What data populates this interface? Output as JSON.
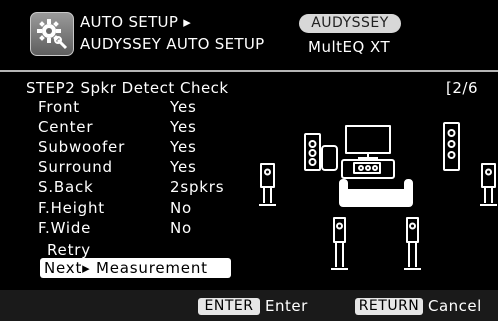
{
  "header": {
    "line1": "AUTO SETUP ▸",
    "line2": "AUDYSSEY AUTO SETUP",
    "badge": "AUDYSSEY",
    "subtitle": "MultEQ XT",
    "icon": "setup-gear-icon"
  },
  "step": {
    "title": "STEP2 Spkr Detect Check",
    "page": "[2/6"
  },
  "speakers": [
    {
      "label": "Front",
      "value": "Yes"
    },
    {
      "label": "Center",
      "value": "Yes"
    },
    {
      "label": "Subwoofer",
      "value": "Yes"
    },
    {
      "label": "Surround",
      "value": "Yes"
    },
    {
      "label": "S.Back",
      "value": "2spkrs"
    },
    {
      "label": "F.Height",
      "value": "No"
    },
    {
      "label": "F.Wide",
      "value": "No"
    }
  ],
  "actions": {
    "retry": "Retry",
    "next": "Next▸ Measurement"
  },
  "footer": {
    "enter_key": "ENTER",
    "enter_label": "Enter",
    "return_key": "RETURN",
    "return_label": "Cancel"
  },
  "colors": {
    "background": "#000000",
    "text": "#ffffff",
    "highlight": "#ffffff",
    "badge": "#d8d8d8"
  }
}
